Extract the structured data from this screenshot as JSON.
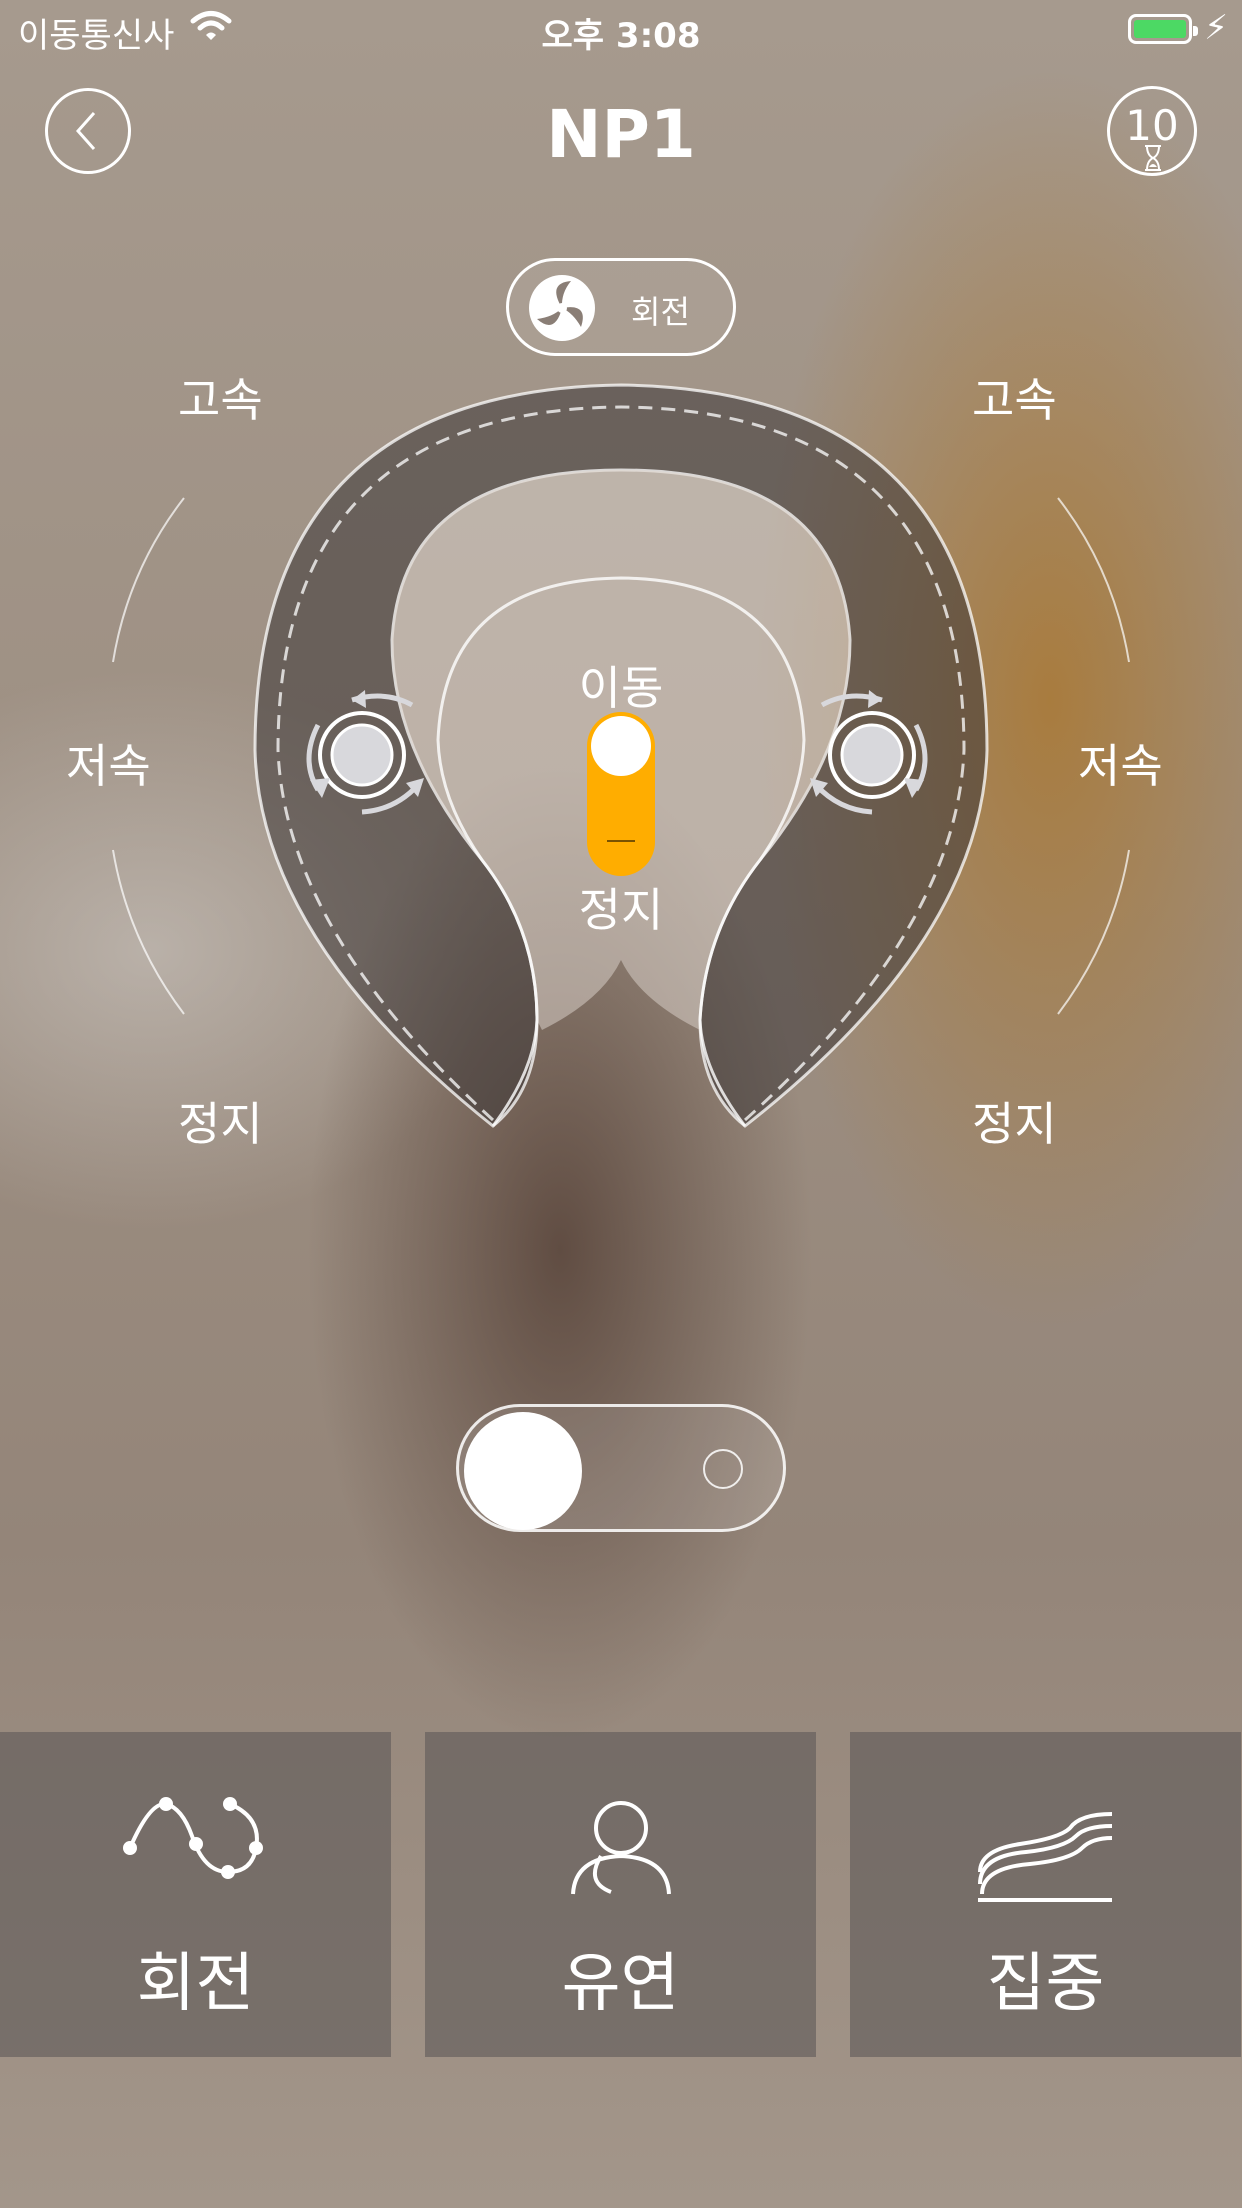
{
  "status_bar": {
    "carrier": "이동통신사",
    "time": "오후 3:08"
  },
  "nav": {
    "title": "NP1",
    "timer_value": "10"
  },
  "mode_pill": {
    "label": "회전"
  },
  "speed_labels": {
    "left": {
      "top": "고속",
      "middle": "저속",
      "bottom": "정지"
    },
    "right": {
      "top": "고속",
      "middle": "저속",
      "bottom": "정지"
    }
  },
  "center_toggle": {
    "top_label": "이동",
    "bottom_label": "정지",
    "active_color": "#ffad00"
  },
  "mode_buttons": [
    {
      "label": "회전",
      "icon": "rotation-wave-icon"
    },
    {
      "label": "유연",
      "icon": "person-icon"
    },
    {
      "label": "집중",
      "icon": "wave-lines-icon"
    }
  ]
}
